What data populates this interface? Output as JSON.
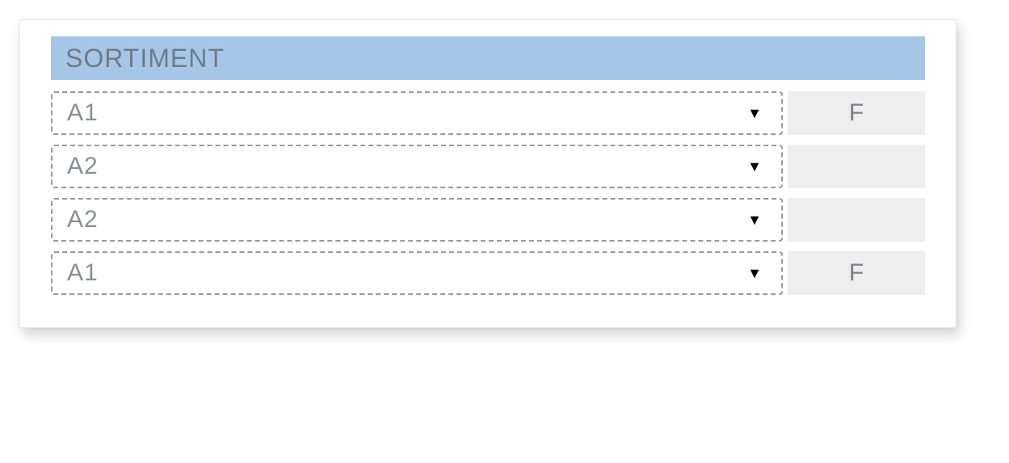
{
  "panel": {
    "title": "SORTIMENT",
    "rows": [
      {
        "value": "A1",
        "badge": "F"
      },
      {
        "value": "A2",
        "badge": ""
      },
      {
        "value": "A2",
        "badge": ""
      },
      {
        "value": "A1",
        "badge": "F"
      }
    ]
  },
  "icons": {
    "caret": "▼"
  }
}
